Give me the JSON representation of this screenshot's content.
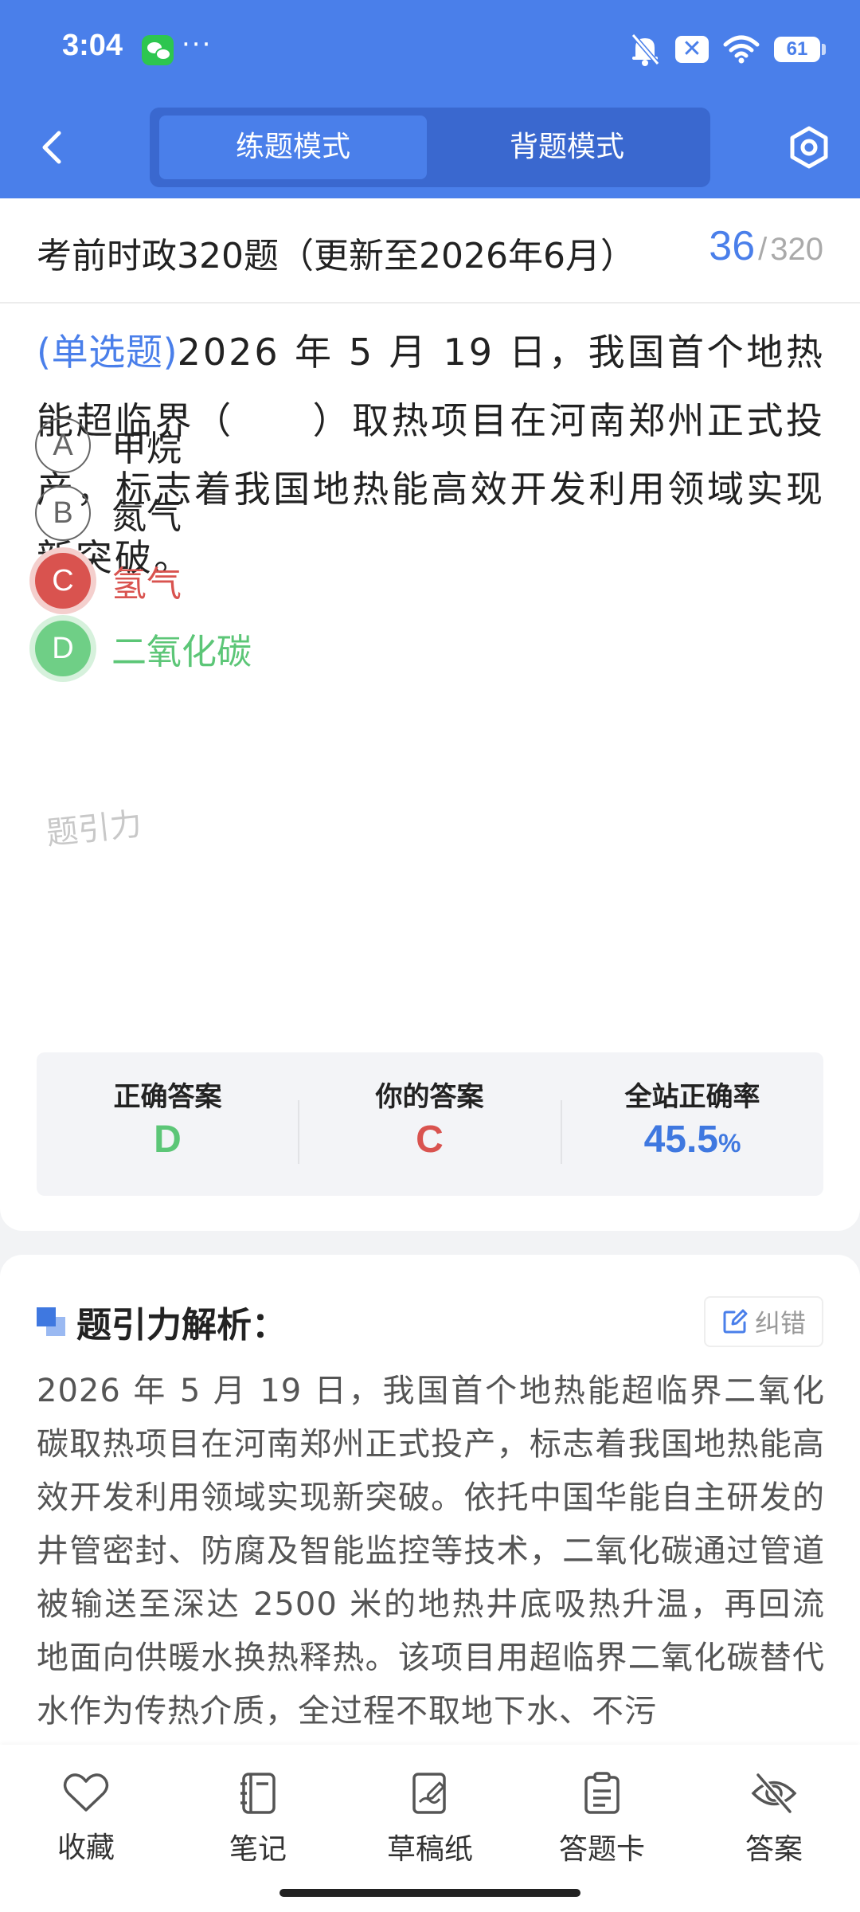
{
  "status": {
    "time": "3:04",
    "dots": "···",
    "battery": "61"
  },
  "nav": {
    "tabs": [
      {
        "label": "练题模式",
        "active": true
      },
      {
        "label": "背题模式",
        "active": false
      }
    ]
  },
  "question_header": {
    "title": "考前时政320题（更新至2026年6月）",
    "current": "36",
    "separator": "/",
    "total": "320"
  },
  "question": {
    "type": "(单选题)",
    "text": "2026 年 5 月 19 日，我国首个地热能超临界（　　）取热项目在河南郑州正式投产，标志着我国地热能高效开发利用领域实现新突破。"
  },
  "options": [
    {
      "letter": "A",
      "text": "甲烷",
      "state": "normal"
    },
    {
      "letter": "B",
      "text": "氮气",
      "state": "normal"
    },
    {
      "letter": "C",
      "text": "氢气",
      "state": "wrong"
    },
    {
      "letter": "D",
      "text": "二氧化碳",
      "state": "right"
    }
  ],
  "watermark": "题引力",
  "stats": {
    "correct_label": "正确答案",
    "correct_value": "D",
    "yours_label": "你的答案",
    "yours_value": "C",
    "rate_label": "全站正确率",
    "rate_value": "45.5",
    "rate_unit": "%"
  },
  "analysis": {
    "title": "题引力解析：",
    "report_label": "纠错",
    "text": "2026 年 5 月 19 日，我国首个地热能超临界二氧化碳取热项目在河南郑州正式投产，标志着我国地热能高效开发利用领域实现新突破。依托中国华能自主研发的井管密封、防腐及智能监控等技术，二氧化碳通过管道被输送至深达 2500 米的地热井底吸热升温，再回流地面向供暖水换热释热。该项目用超临界二氧化碳替代水作为传热介质，全过程不取地下水、不污"
  },
  "toolbar": [
    {
      "label": "收藏",
      "icon": "heart-icon"
    },
    {
      "label": "笔记",
      "icon": "notebook-icon"
    },
    {
      "label": "草稿纸",
      "icon": "draft-icon"
    },
    {
      "label": "答题卡",
      "icon": "clipboard-icon"
    },
    {
      "label": "答案",
      "icon": "eye-off-icon"
    }
  ],
  "colors": {
    "primary": "#4a7fea",
    "wrong": "#d9534f",
    "right": "#5cc677"
  }
}
